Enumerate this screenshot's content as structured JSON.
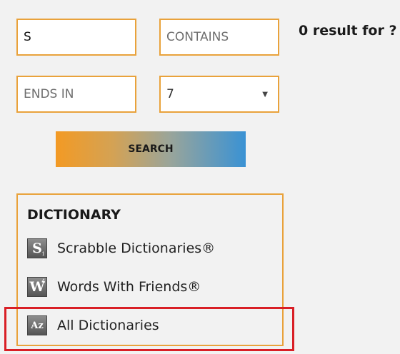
{
  "search": {
    "starts_with_value": "S",
    "contains_placeholder": "CONTAINS",
    "ends_in_placeholder": "ENDS IN",
    "length_selected": "7",
    "button_label": "SEARCH"
  },
  "result_text": "0 result for ?",
  "dictionary": {
    "title": "DICTIONARY",
    "items": [
      {
        "label": "Scrabble Dictionaries®",
        "icon": "scrabble-icon",
        "tile_letter": "S",
        "tile_sub": "1"
      },
      {
        "label": "Words With Friends®",
        "icon": "words-with-friends-icon",
        "tile_letter": "W",
        "tile_sub": "4"
      },
      {
        "label": "All Dictionaries",
        "icon": "all-dictionaries-icon",
        "tile_letter": "Az"
      }
    ]
  },
  "colors": {
    "field_border": "#e9a23b",
    "highlight": "#d91f26",
    "gradient_start": "#f39a24",
    "gradient_end": "#3a92d4"
  }
}
